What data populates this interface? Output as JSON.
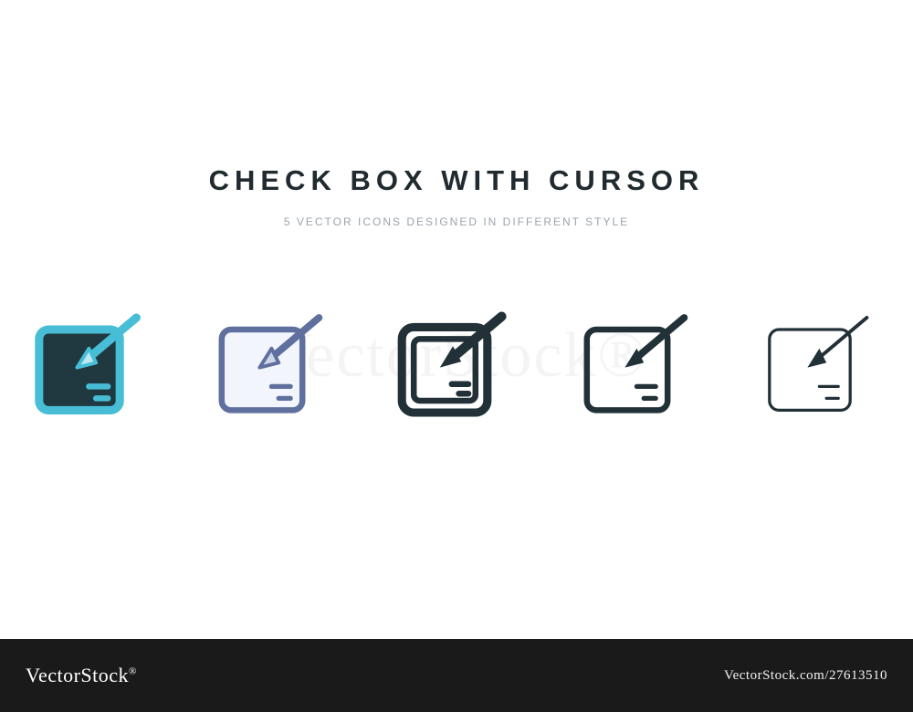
{
  "heading": {
    "title": "CHECK BOX WITH CURSOR",
    "subtitle": "5 VECTOR ICONS DESIGNED IN DIFFERENT STYLE"
  },
  "icons": [
    {
      "name": "checkbox-cursor-filled-teal-icon"
    },
    {
      "name": "checkbox-cursor-outline-blue-icon"
    },
    {
      "name": "checkbox-cursor-bold-dark-icon"
    },
    {
      "name": "checkbox-cursor-outline-dark-icon"
    },
    {
      "name": "checkbox-cursor-thin-dark-icon"
    }
  ],
  "footer": {
    "brand_prefix": "Vector",
    "brand_suffix": "Stock",
    "id_label": "VectorStock.com/27613510"
  },
  "watermark": "VectorStock®",
  "colors": {
    "teal": "#47bdd6",
    "dark_teal": "#20383f",
    "slate_blue": "#5f6f9e",
    "light_blue": "#bfe8f2",
    "dark": "#223138",
    "subtitle": "#9aa4ab"
  }
}
